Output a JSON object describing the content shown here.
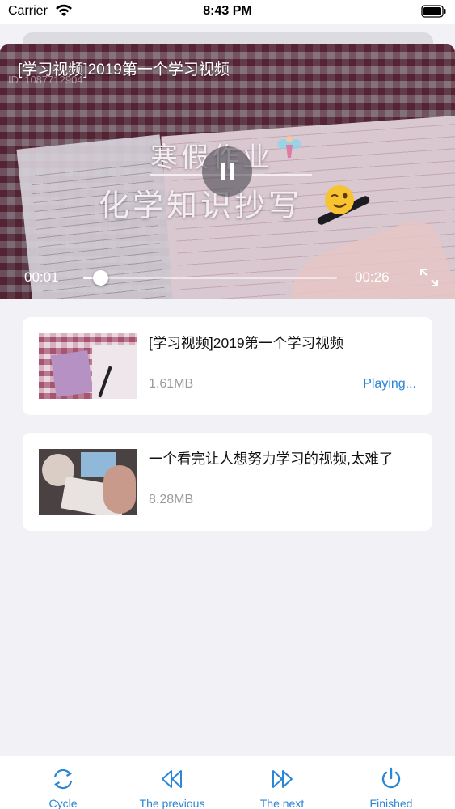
{
  "status_bar": {
    "carrier": "Carrier",
    "time": "8:43 PM"
  },
  "player": {
    "title": "[学习视频]2019第一个学习视频",
    "id_text": "ID: 1087712904",
    "overlay_line1": "寒假作业",
    "overlay_line2": "化学知识抄写",
    "current_time": "00:01",
    "total_time": "00:26",
    "progress_fraction": 0.07
  },
  "playlist": [
    {
      "title": "[学习视频]2019第一个学习视频",
      "size": "1.61MB",
      "status": "Playing..."
    },
    {
      "title": "一个看完让人想努力学习的视频,太难了",
      "size": "8.28MB",
      "status": ""
    }
  ],
  "toolbar": {
    "cycle": "Cycle",
    "previous": "The previous",
    "next": "The next",
    "finished": "Finished"
  },
  "colors": {
    "accent": "#2a86d6",
    "background": "#f2f2f6"
  },
  "icons": [
    "wifi-icon",
    "battery-icon",
    "pause-icon",
    "fullscreen-icon",
    "cycle-icon",
    "previous-icon",
    "next-icon",
    "power-icon"
  ]
}
